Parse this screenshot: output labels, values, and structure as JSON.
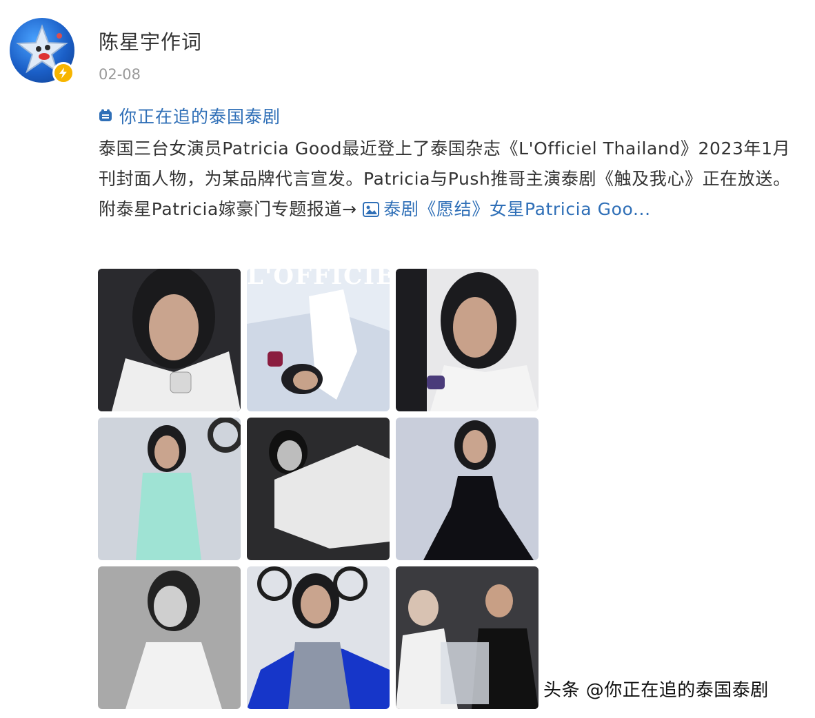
{
  "author": {
    "name": "陈星宇作词",
    "avatar_icon": "star-mascot-avatar",
    "badge_icon": "lightning-verified-badge",
    "badge_color": "#f7b500"
  },
  "post": {
    "time": "02-08",
    "topic_icon": "hashtag-topic-icon",
    "topic": "你正在追的泰国泰剧",
    "text": "泰国三台女演员Patricia Good最近登上了泰国杂志《L'Officiel Thailand》2023年1月刊封面人物，为某品牌代言宣发。Patricia与Push推哥主演泰剧《触及我心》正在放送。附泰星Patricia嫁豪门专题报道→ ",
    "link_icon": "image-link-icon",
    "link_text": "泰剧《愿结》女星Patricia Goo...",
    "link_color": "#2f6fb7"
  },
  "photos": {
    "cover_masthead": "L'OFFICIEL",
    "items": [
      {
        "name": "photo-portrait-white-shirt"
      },
      {
        "name": "photo-magazine-cover"
      },
      {
        "name": "photo-portrait-leaning"
      },
      {
        "name": "photo-mint-dress"
      },
      {
        "name": "photo-reclining-bw"
      },
      {
        "name": "photo-black-dress"
      },
      {
        "name": "photo-bw-blazer"
      },
      {
        "name": "photo-blue-sequin"
      },
      {
        "name": "photo-wedding-champagne"
      }
    ]
  },
  "watermark": {
    "text": "头条 @你正在追的泰国泰剧"
  }
}
